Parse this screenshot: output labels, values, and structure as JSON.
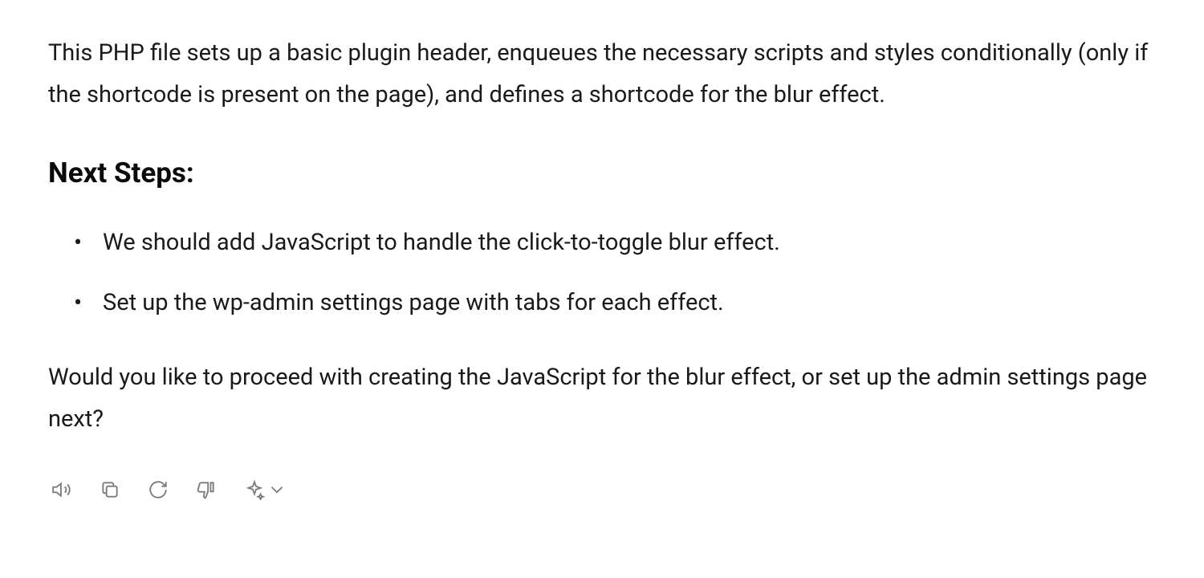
{
  "content": {
    "intro_paragraph": "This PHP file sets up a basic plugin header, enqueues the necessary scripts and styles conditionally (only if the shortcode is present on the page), and defines a shortcode for the blur effect.",
    "next_steps_heading": "Next Steps:",
    "steps": [
      "We should add JavaScript to handle the click-to-toggle blur effect.",
      "Set up the wp-admin settings page with tabs for each effect."
    ],
    "closing_question": "Would you like to proceed with creating the JavaScript for the blur effect, or set up the admin settings page next?"
  },
  "toolbar": {
    "speaker": "Read aloud",
    "copy": "Copy",
    "refresh": "Regenerate",
    "thumbs_down": "Bad response",
    "sparkle": "More"
  }
}
